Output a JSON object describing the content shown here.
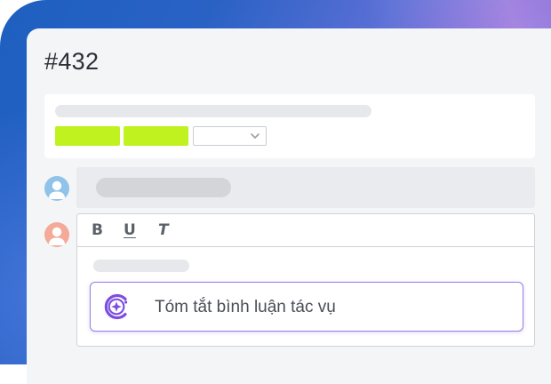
{
  "ticket": {
    "id": "#432"
  },
  "info": {
    "tag_colors": [
      "#bff21f",
      "#bff21f"
    ],
    "select_value": ""
  },
  "editor": {
    "toolbar": {
      "bold_label": "B",
      "underline_label": "U",
      "italic_label": "T"
    }
  },
  "ai_suggestion": {
    "label": "Tóm tắt bình luận tác vụ",
    "icon": "ai-sparkle-icon",
    "accent": "#8b5cf6"
  },
  "avatars": [
    {
      "icon": "user-icon",
      "color": "#8fc3ea"
    },
    {
      "icon": "user-icon",
      "color": "#f4a999"
    }
  ]
}
